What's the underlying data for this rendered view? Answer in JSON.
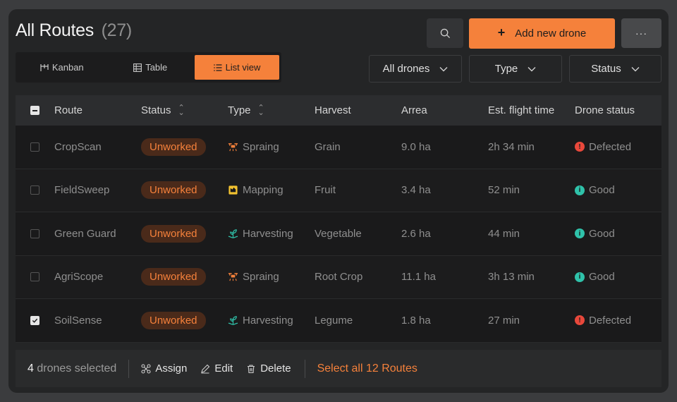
{
  "header": {
    "title": "All Routes",
    "count": "(27)",
    "add_label": "Add new drone",
    "more_label": "···"
  },
  "views": [
    {
      "label": "Kanban",
      "icon": "kanban-icon"
    },
    {
      "label": "Table",
      "icon": "table-icon"
    },
    {
      "label": "List view",
      "icon": "list-icon",
      "active": true
    }
  ],
  "filters": [
    {
      "label": "All drones"
    },
    {
      "label": "Type"
    },
    {
      "label": "Status"
    }
  ],
  "table": {
    "columns": [
      "Route",
      "Status",
      "Type",
      "Harvest",
      "Arrea",
      "Est. flight time",
      "Drone status"
    ],
    "rows": [
      {
        "route": "CropScan",
        "status": "Unworked",
        "type": "Spraing",
        "harvest": "Grain",
        "area": "9.0 ha",
        "flight": "2h 34 min",
        "drone": "Defected",
        "checked": false
      },
      {
        "route": "FieldSweep",
        "status": "Unworked",
        "type": "Mapping",
        "harvest": "Fruit",
        "area": "3.4 ha",
        "flight": "52 min",
        "drone": "Good",
        "checked": false
      },
      {
        "route": "Green Guard",
        "status": "Unworked",
        "type": "Harvesting",
        "harvest": "Vegetable",
        "area": "2.6 ha",
        "flight": "44 min",
        "drone": "Good",
        "checked": false
      },
      {
        "route": "AgriScope",
        "status": "Unworked",
        "type": "Spraing",
        "harvest": "Root Crop",
        "area": "11.1 ha",
        "flight": "3h 13 min",
        "drone": "Good",
        "checked": false
      },
      {
        "route": "SoilSense",
        "status": "Unworked",
        "type": "Harvesting",
        "harvest": "Legume",
        "area": "1.8 ha",
        "flight": "27 min",
        "drone": "Defected",
        "checked": true
      }
    ]
  },
  "footer": {
    "selected_count": "4",
    "selected_label": "drones selected",
    "assign": "Assign",
    "edit": "Edit",
    "delete": "Delete",
    "select_all": "Select all 12 Routes"
  },
  "colors": {
    "accent": "#f5813b",
    "defected": "#e8483b",
    "good": "#2fc2aa"
  }
}
